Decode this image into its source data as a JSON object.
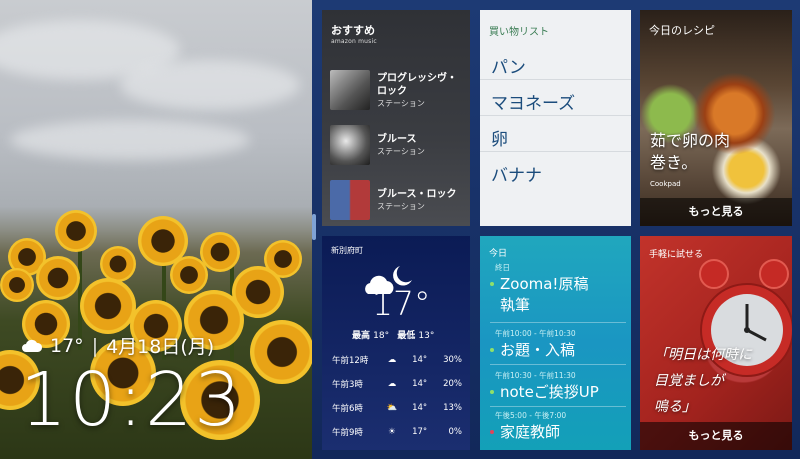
{
  "clock": {
    "weather_temp": "17°",
    "date": "4月18日(月)",
    "time": "10:23"
  },
  "music": {
    "title": "おすすめ",
    "logo": "amazon music",
    "items": [
      {
        "name": "プログレッシヴ・ロック",
        "sub": "ステーション"
      },
      {
        "name": "ブルース",
        "sub": "ステーション"
      },
      {
        "name": "ブルース・ロック",
        "sub": "ステーション"
      }
    ]
  },
  "shopping": {
    "title": "買い物リスト",
    "items": [
      "パン",
      "マヨネーズ",
      "卵",
      "バナナ"
    ]
  },
  "recipe": {
    "title": "今日のレシピ",
    "name_line1": "茹で卵の肉",
    "name_line2": "巻き。",
    "source": "Cookpad",
    "more": "もっと見る"
  },
  "weather": {
    "city": "新別府町",
    "temp": "17°",
    "high_label": "最高",
    "high": "18°",
    "low_label": "最低",
    "low": "13°",
    "hours": [
      {
        "time": "午前12時",
        "icon": "cloud-icon",
        "temp": "14°",
        "precip": "30%"
      },
      {
        "time": "午前3時",
        "icon": "cloud-icon",
        "temp": "14°",
        "precip": "20%"
      },
      {
        "time": "午前6時",
        "icon": "partly-cloudy-icon",
        "temp": "14°",
        "precip": "13%"
      },
      {
        "time": "午前9時",
        "icon": "sun-icon",
        "temp": "17°",
        "precip": "0%"
      }
    ]
  },
  "today": {
    "title": "今日",
    "events": [
      {
        "time": "終日",
        "name": "Zooma!原稿",
        "name2": "執筆",
        "dot": "#8fe06a"
      },
      {
        "time": "午前10:00 - 午前10:30",
        "name": "お題・入稿",
        "dot": "#8fe06a"
      },
      {
        "time": "午前10:30 - 午前11:30",
        "name": "noteご挨拶UP",
        "dot": "#8fe06a"
      },
      {
        "time": "午後5:00 - 午後7:00",
        "name": "家庭教師",
        "dot": "#e0455a"
      }
    ]
  },
  "alarm": {
    "title": "手軽に試せる",
    "line1": "「明日は何時に",
    "line2": "目覚ましが",
    "line3": "鳴る」",
    "more": "もっと見る"
  }
}
